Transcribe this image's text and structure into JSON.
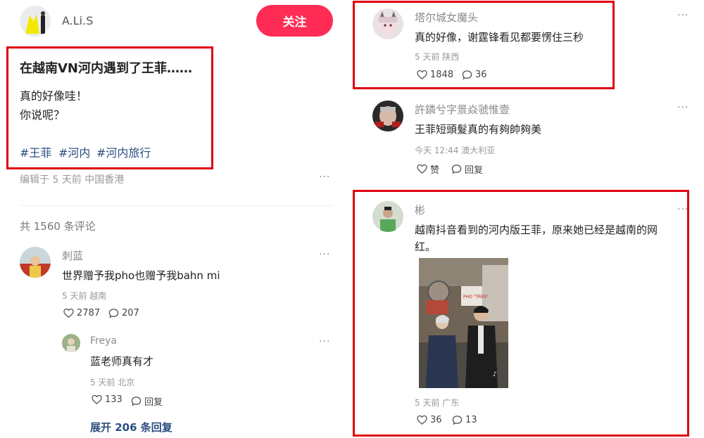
{
  "post": {
    "author": "A.Li.S",
    "follow_label": "关注",
    "title": "在越南VN河内遇到了王菲……",
    "body_lines": [
      "真的好像哇！",
      "你说呢？"
    ],
    "tags": [
      "#王菲",
      "#河内",
      "#河内旅行"
    ],
    "edit_info": "编辑于 5 天前 中国香港",
    "more": "···"
  },
  "comments_header": {
    "count_label": "共 1560 条评论"
  },
  "left_comments": [
    {
      "user": "刺蓝",
      "text": "世界赠予我pho也赠予我bahn mi",
      "meta": "5 天前 越南",
      "likes": "2787",
      "replies": "207",
      "more": "···"
    }
  ],
  "reply": {
    "user": "Freya",
    "text": "蓝老师真有才",
    "meta": "5 天前 北京",
    "likes": "133",
    "reply_label": "回复",
    "more": "···"
  },
  "expand_label": "展开 206 条回复",
  "right_comments": [
    {
      "user": "塔尔城女魔头",
      "text": "真的好像，谢霆锋看见都要愣住三秒",
      "meta": "5 天前 陕西",
      "likes": "1848",
      "replies": "36",
      "more": "···"
    },
    {
      "user": "許鏻兮字景焱虢惟壹",
      "text": "王菲短頭髮真的有夠帥夠美",
      "meta": "今天 12:44 澳大利亚",
      "likes": "赞",
      "replies": "回复",
      "more": "···"
    },
    {
      "user": "彬",
      "text_line1": "越南抖音看到的河内版王菲，原来她已经是越南的网",
      "text_line2": "红。",
      "meta": "5 天前 广东",
      "likes": "36",
      "replies": "13",
      "more": "···",
      "image_sign": "PHO \"TRES\""
    }
  ],
  "colors": {
    "accent": "#ff2d55",
    "tag": "#2b4e80",
    "highlight_box": "#e0000f"
  }
}
